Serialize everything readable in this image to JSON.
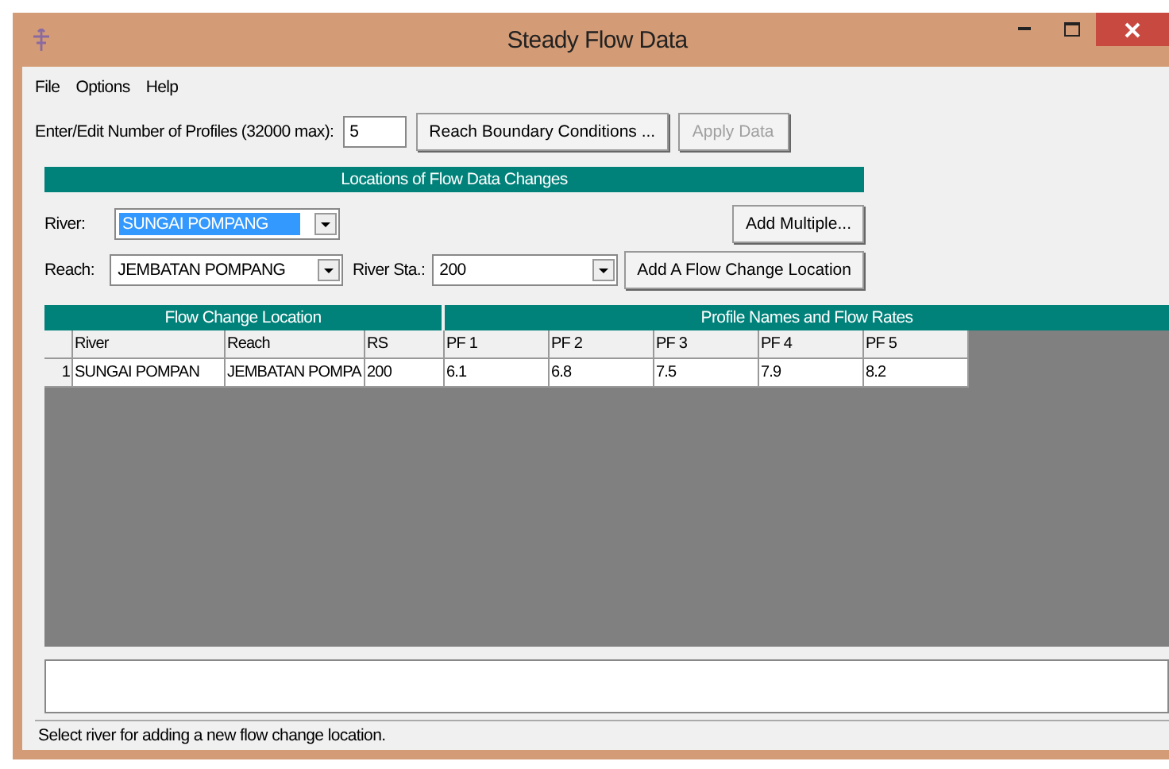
{
  "window": {
    "title": "Steady Flow Data"
  },
  "menu": [
    {
      "label": "File"
    },
    {
      "label": "Options"
    },
    {
      "label": "Help"
    }
  ],
  "profiles": {
    "label": "Enter/Edit Number of Profiles (32000 max):",
    "value": "5"
  },
  "top_buttons": [
    {
      "label": "Reach Boundary Conditions ...",
      "disabled": false
    },
    {
      "label": "Apply Data",
      "disabled": true
    }
  ],
  "locations": {
    "title": "Locations of Flow Data Changes",
    "river": {
      "label": "River:",
      "value": "SUNGAI POMPANG",
      "highlighted": true
    },
    "reach": {
      "label": "Reach:",
      "value": "JEMBATAN POMPANG",
      "highlighted": false
    },
    "river_sta": {
      "label": "River Sta.:",
      "value": "200",
      "highlighted": false
    },
    "add_multiple": "Add Multiple...",
    "add_location": "Add A Flow Change Location"
  },
  "table": {
    "group_left": "Flow Change Location",
    "group_right": "Profile Names and Flow Rates",
    "columns": [
      "River",
      "Reach",
      "RS",
      "PF 1",
      "PF 2",
      "PF 3",
      "PF 4",
      "PF 5"
    ],
    "rows": [
      {
        "number": "1",
        "cells": [
          "SUNGAI POMPAN",
          "JEMBATAN POMPA",
          "200",
          "6.1",
          "6.8",
          "7.5",
          "7.9",
          "8.2"
        ]
      }
    ]
  },
  "status_bar": "Select river for adding a new flow change location."
}
